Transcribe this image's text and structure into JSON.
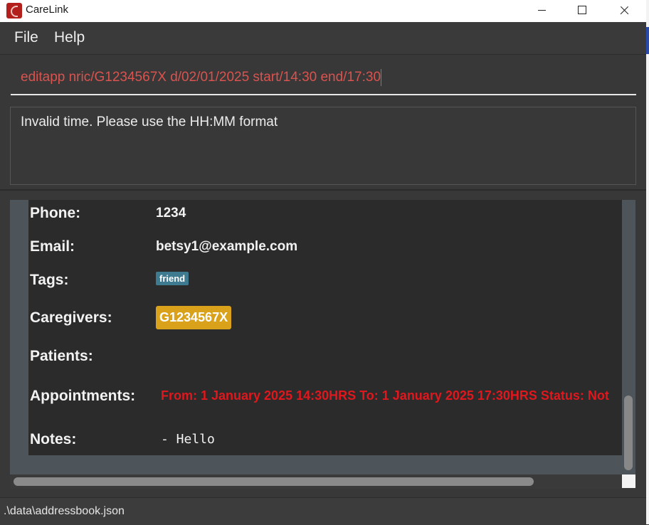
{
  "window": {
    "title": "CareLink"
  },
  "menu": {
    "file": "File",
    "help": "Help"
  },
  "command": {
    "value": "editapp nric/G1234567X d/02/01/2025 start/14:30 end/17:30"
  },
  "result": {
    "message": "Invalid time. Please use the HH:MM format"
  },
  "person": {
    "phone_label": "Phone:",
    "phone": "1234",
    "email_label": "Email:",
    "email": "betsy1@example.com",
    "tags_label": "Tags:",
    "tags": [
      "friend"
    ],
    "caregivers_label": "Caregivers:",
    "caregivers": [
      "G1234567X"
    ],
    "patients_label": "Patients:",
    "appointments_label": "Appointments:",
    "appointment": "From: 1 January 2025 14:30HRS To: 1 January 2025 17:30HRS Status: Not",
    "notes_label": "Notes:",
    "notes": "- Hello"
  },
  "status": {
    "path": ".\\data\\addressbook.json"
  },
  "colors": {
    "command_text": "#d9534f",
    "tag": "#3e7b91",
    "caregiver_tag": "#d9a21a",
    "appointment_text": "#e0171d"
  }
}
